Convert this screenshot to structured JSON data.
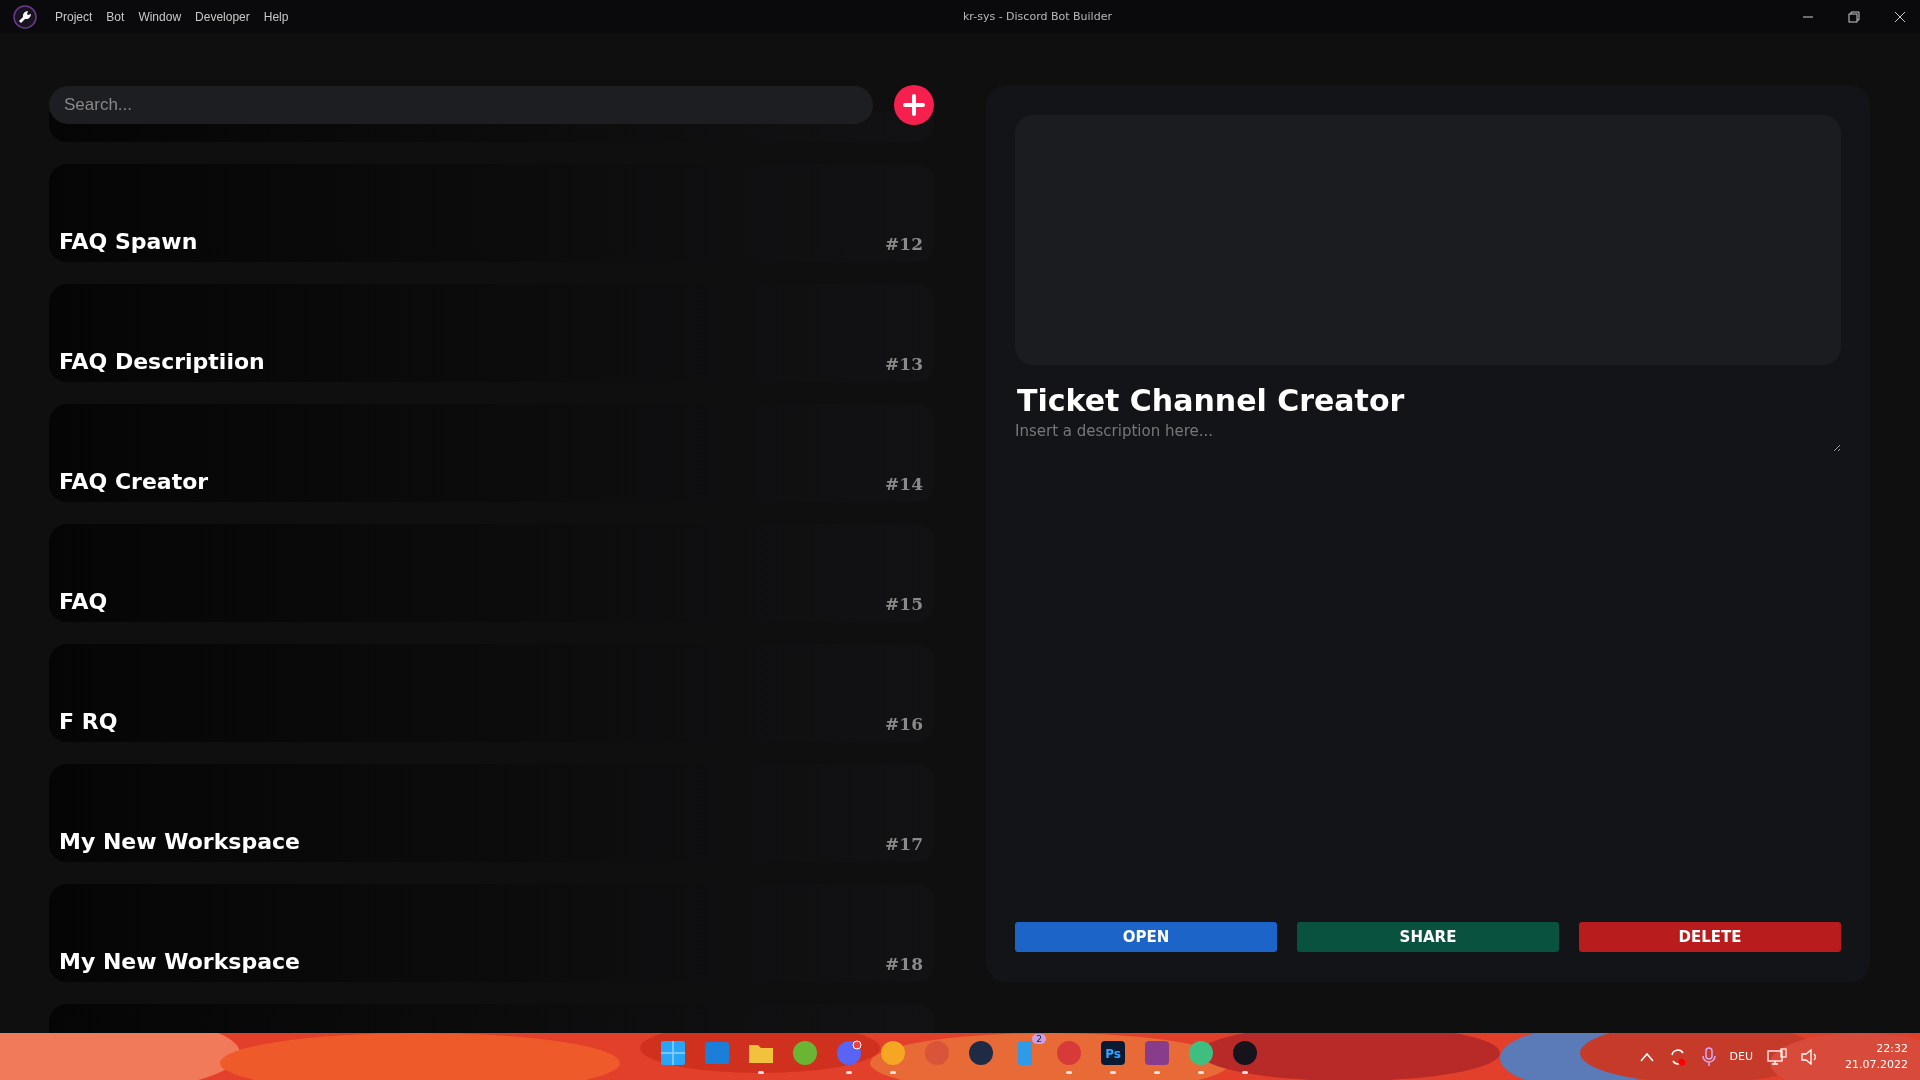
{
  "window": {
    "title": "kr-sys - Discord Bot Builder"
  },
  "menu": [
    "Project",
    "Bot",
    "Window",
    "Developer",
    "Help"
  ],
  "search": {
    "placeholder": "Search..."
  },
  "workspaces": [
    {
      "name": "FAQ Spawn",
      "number": "#12"
    },
    {
      "name": "FAQ Descriptiion",
      "number": "#13"
    },
    {
      "name": "FAQ Creator",
      "number": "#14"
    },
    {
      "name": "FAQ",
      "number": "#15"
    },
    {
      "name": "F RQ",
      "number": "#16"
    },
    {
      "name": "My New Workspace",
      "number": "#17"
    },
    {
      "name": "My New Workspace",
      "number": "#18"
    }
  ],
  "detail": {
    "title": "Ticket Channel Creator",
    "description": {
      "placeholder": "Insert a description here..."
    },
    "buttons": [
      {
        "label": "OPEN",
        "kind": "open"
      },
      {
        "label": "SHARE",
        "kind": "share"
      },
      {
        "label": "DELETE",
        "kind": "delete"
      }
    ]
  },
  "taskbar": {
    "apps": [
      {
        "kind": "start",
        "running": false
      },
      {
        "kind": "widgets",
        "running": false
      },
      {
        "kind": "folder",
        "running": true
      },
      {
        "kind": "torrent",
        "running": false
      },
      {
        "kind": "chat",
        "running": true,
        "alert": true
      },
      {
        "kind": "chat-alt",
        "running": true
      },
      {
        "kind": "faded",
        "running": false
      },
      {
        "kind": "cloud",
        "running": false
      },
      {
        "kind": "phone",
        "running": false,
        "badge": "2"
      },
      {
        "kind": "browser",
        "running": true
      },
      {
        "kind": "ps",
        "running": true,
        "text": "Ps"
      },
      {
        "kind": "archive",
        "running": true
      },
      {
        "kind": "atom",
        "running": true
      },
      {
        "kind": "builder",
        "running": true
      }
    ],
    "tray": {
      "language": "DEU",
      "time": "22:32",
      "date": "21.07.2022"
    }
  }
}
